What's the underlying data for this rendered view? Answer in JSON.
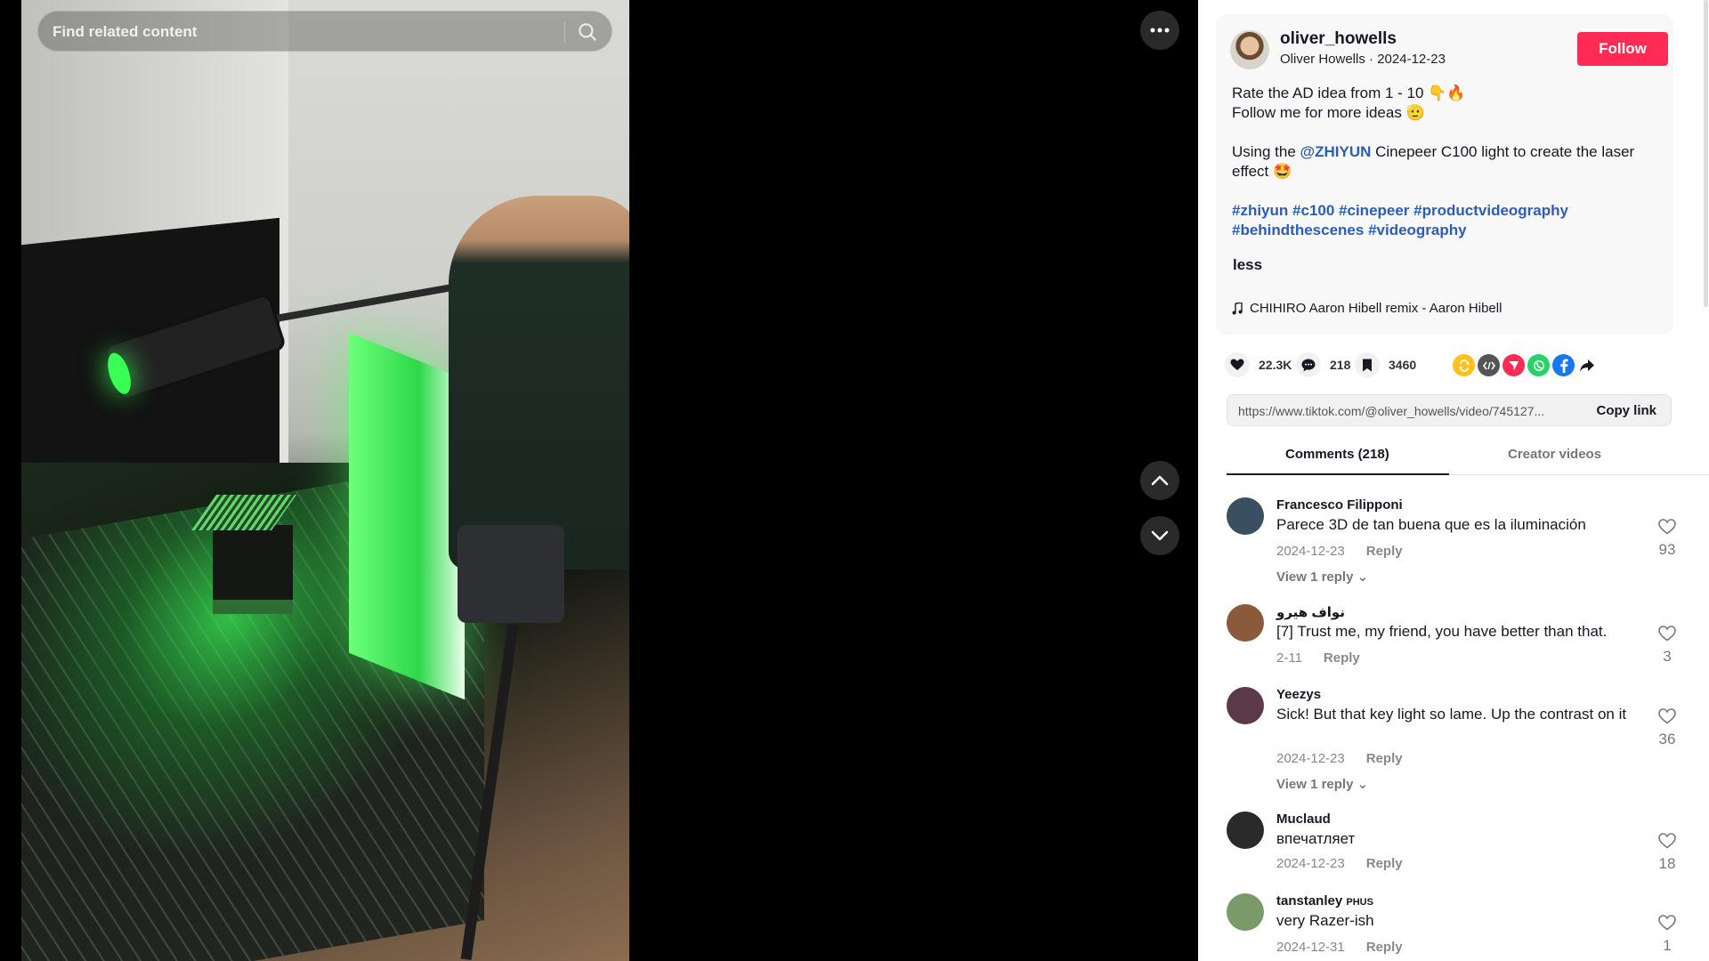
{
  "search": {
    "placeholder": "Find related content"
  },
  "post": {
    "username": "oliver_howells",
    "display_name": "Oliver Howells",
    "date": "2024-12-23",
    "follow_label": "Follow",
    "caption_line1": "Rate the AD idea from 1 - 10 👇🔥",
    "caption_line2": "Follow me for more ideas 🫡",
    "using_prefix": "Using the ",
    "mention": "@ZHIYUN",
    "using_suffix": " Cinepeer C100 light to create the laser effect 🤩",
    "hashtags_line1": [
      "#zhiyun",
      "#c100",
      "#cinepeer",
      "#productvideography"
    ],
    "hashtags_line2": [
      "#behindthescenes",
      "#videography"
    ],
    "less_label": "less",
    "music": "CHIHIRO Aaron Hibell remix - Aaron Hibell"
  },
  "stats": {
    "likes": "22.3K",
    "comments": "218",
    "saves": "3460"
  },
  "share_icons": [
    {
      "name": "repost-icon",
      "color": "#ffc21a"
    },
    {
      "name": "embed-icon",
      "color": "#555555"
    },
    {
      "name": "send-icon",
      "color": "#fe2c55"
    },
    {
      "name": "whatsapp-icon",
      "color": "#25d366"
    },
    {
      "name": "facebook-icon",
      "color": "#1877f2"
    },
    {
      "name": "share-arrow-icon",
      "color": "#161823"
    }
  ],
  "link": {
    "url": "https://www.tiktok.com/@oliver_howells/video/745127...",
    "copy_label": "Copy link"
  },
  "tabs": [
    {
      "label": "Comments (218)"
    },
    {
      "label": "Creator videos"
    }
  ],
  "comments": [
    {
      "name": "Francesco Filipponi",
      "text": "Parece 3D de tan buena que es la iluminación",
      "date": "2024-12-23",
      "reply": "Reply",
      "likes": "93",
      "view_replies": "View 1 reply",
      "avatar_color": "#3a5060"
    },
    {
      "name": "نواف هيرو",
      "text": "[7] Trust me, my friend, you have better than that.",
      "date": "2-11",
      "reply": "Reply",
      "likes": "3",
      "view_replies": "",
      "avatar_color": "#8a5a3a"
    },
    {
      "name": "Yeezys",
      "text": "Sick! But that key light so lame. Up the contrast on it",
      "date": "2024-12-23",
      "reply": "Reply",
      "likes": "36",
      "view_replies": "View 1 reply",
      "avatar_color": "#5a3a48"
    },
    {
      "name": "Muclaud",
      "text": "впечатляет",
      "date": "2024-12-23",
      "reply": "Reply",
      "likes": "18",
      "view_replies": "",
      "avatar_color": "#2a2a2a"
    },
    {
      "name": "tanstanley",
      "badge": "PHUS",
      "text": "very Razer-ish",
      "date": "2024-12-31",
      "reply": "Reply",
      "likes": "1",
      "view_replies": "",
      "avatar_color": "#7a9a6a"
    }
  ]
}
